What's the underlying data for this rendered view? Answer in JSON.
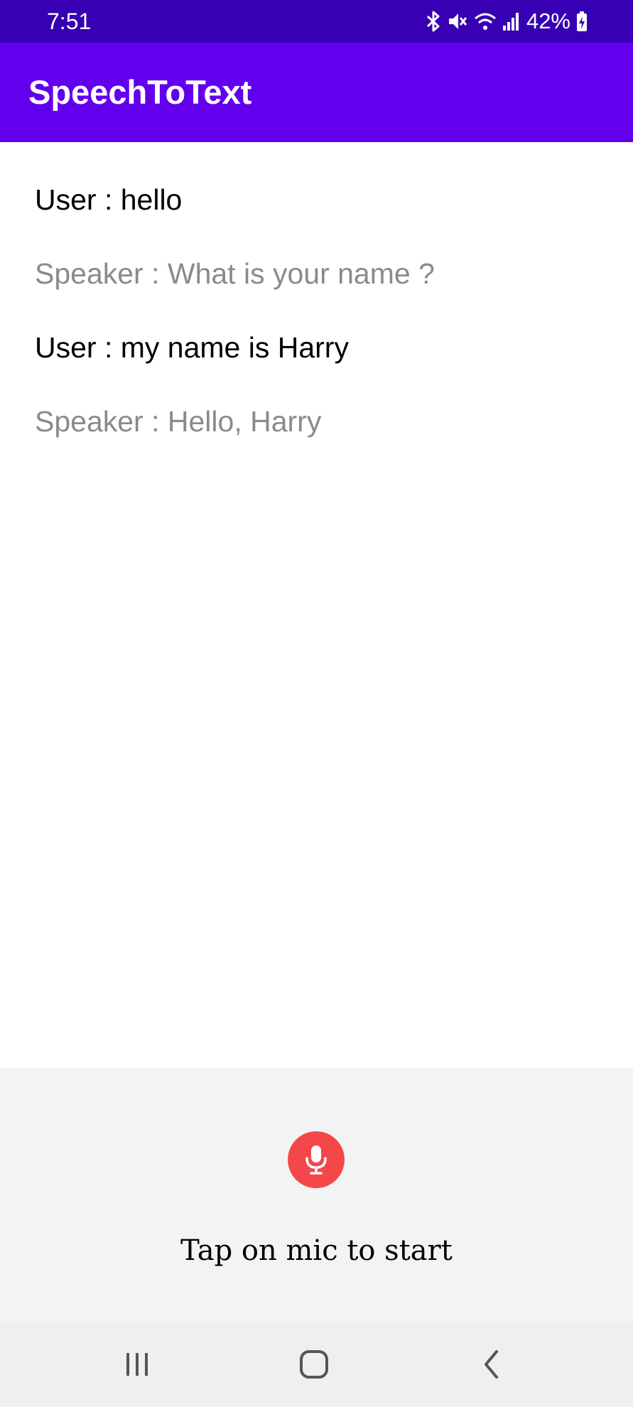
{
  "status_bar": {
    "time": "7:51",
    "battery": "42%",
    "icons": [
      "bluetooth-icon",
      "mute-icon",
      "wifi-icon",
      "signal-icon",
      "battery-charging-icon"
    ]
  },
  "app_bar": {
    "title": "SpeechToText"
  },
  "conversation": {
    "messages": [
      {
        "role": "user",
        "text": "User : hello"
      },
      {
        "role": "speaker",
        "text": "Speaker : What is your name ?"
      },
      {
        "role": "user",
        "text": "User : my name is Harry"
      },
      {
        "role": "speaker",
        "text": "Speaker : Hello, Harry"
      }
    ]
  },
  "mic_panel": {
    "icon": "microphone-icon",
    "hint": "Tap on mic to start"
  },
  "navigation_bar": {
    "buttons": [
      "recent-apps-icon",
      "home-icon",
      "back-icon"
    ]
  },
  "colors": {
    "status_bar": "#3700b3",
    "app_bar": "#6200ee",
    "mic_button": "#f4474a",
    "speaker_text": "#8a8a8a",
    "user_text": "#000000",
    "bottom_panel": "#f3f3f3"
  }
}
